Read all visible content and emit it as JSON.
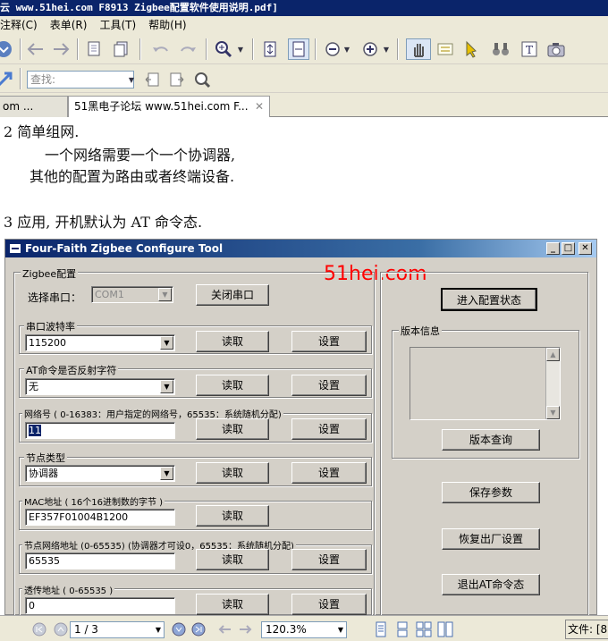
{
  "window": {
    "title": "云 www.51hei.com F8913 Zigbee配置软件使用说明.pdf]"
  },
  "menu": [
    "注释(C)",
    "表单(R)",
    "工具(T)",
    "帮助(H)"
  ],
  "search": {
    "placeholder": "查找:"
  },
  "tabs": [
    {
      "label": "om ..."
    },
    {
      "label": "51黑电子论坛 www.51hei.com F...",
      "close": "✕"
    }
  ],
  "doc": {
    "line1": "2 简单组网.",
    "line2": "一个网络需要一个一个协调器,",
    "line3": "其他的配置为路由或者终端设备.",
    "line4": "3 应用, 开机默认为 AT 命令态."
  },
  "app": {
    "title": "Four-Faith Zigbee Configure Tool",
    "watermark": "51hei.com",
    "watermark_color": "#ff0000",
    "zigbee_group": "Zigbee配置",
    "port_label": "选择串口：",
    "port_value": "COM1",
    "close_port": "关闭串口",
    "enter_config": "进入配置状态",
    "read": "读取",
    "set": "设置",
    "baud_label": "串口波特率",
    "baud_value": "115200",
    "echo_label": "AT命令是否反射字符",
    "echo_value": "无",
    "netid_label": "网络号 ( 0-16383：用户指定的网络号，65535：系统随机分配)",
    "netid_value": "11",
    "nodetype_label": "节点类型",
    "nodetype_value": "协调器",
    "mac_label": "MAC地址 ( 16个16进制数的字节 )",
    "mac_value": "EF357F01004B1200",
    "netaddr_label": "节点网络地址 (0-65535) (协调器才可设0，65535：系统随机分配)",
    "netaddr_value": "65535",
    "trans_label": "透传地址 ( 0-65535 )",
    "trans_value": "0",
    "version_group": "版本信息",
    "version_query": "版本查询",
    "save_params": "保存参数",
    "factory_reset": "恢复出厂设置",
    "exit_at": "退出AT命令态"
  },
  "status": {
    "page": "1 / 3",
    "zoom": "120.3%",
    "right_text": "文件: [8"
  }
}
